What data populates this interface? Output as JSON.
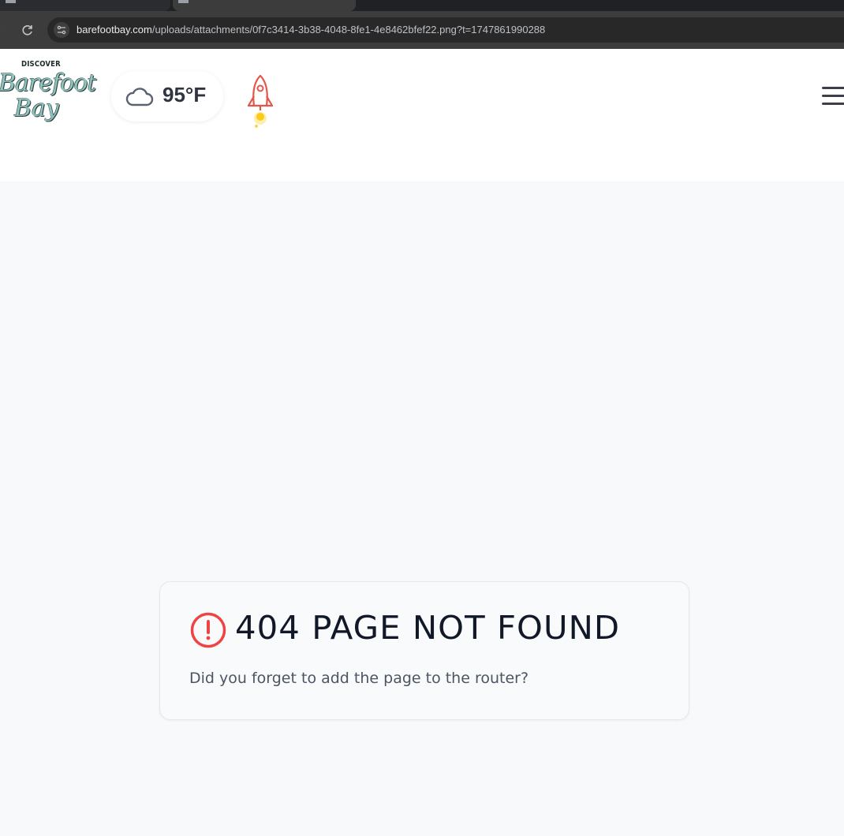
{
  "browser": {
    "url_host": "barefootbay.com",
    "url_path": "/uploads/attachments/0f7c3414-3b38-4048-8fe1-4e8462bfef22.png?t=1747861990288"
  },
  "header": {
    "logo": {
      "top": "DISCOVER",
      "line1": "Barefoot",
      "line2": "Bay"
    },
    "weather": {
      "icon": "cloud-icon",
      "temperature": "95°F"
    },
    "rocket_icon": "rocket-icon",
    "menu_icon": "hamburger-menu-icon"
  },
  "error_card": {
    "icon": "alert-circle-icon",
    "icon_color": "#ef4444",
    "title": "404 PAGE NOT FOUND",
    "message": "Did you forget to add the page to the router?"
  }
}
